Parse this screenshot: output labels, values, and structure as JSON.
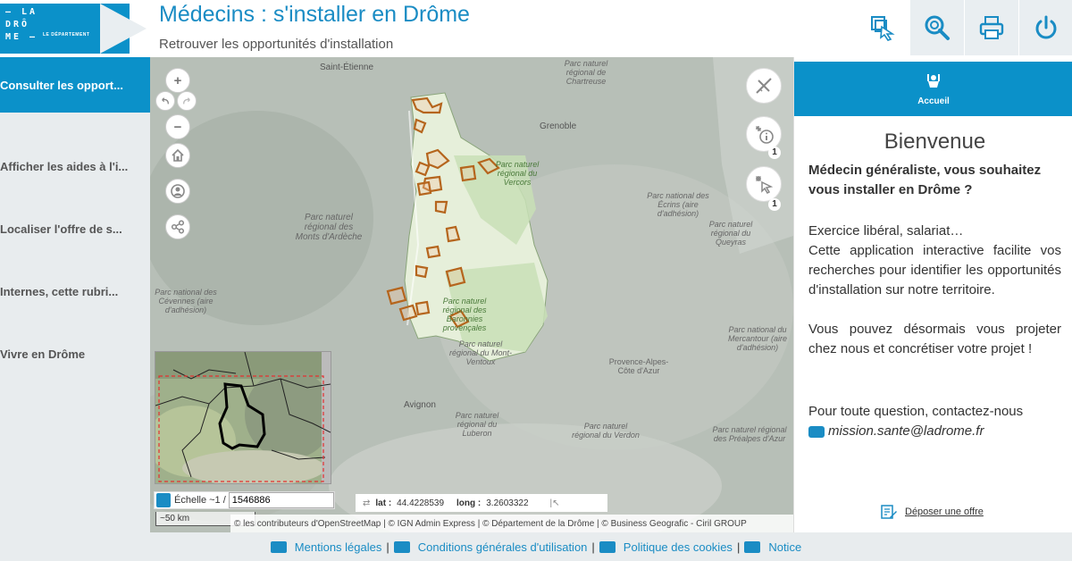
{
  "header": {
    "logo_lines": [
      "– LA",
      "DRÔ",
      "ME –"
    ],
    "logo_subtitle": "LE DÉPARTEMENT",
    "title": "Médecins : s'installer en Drôme",
    "subtitle": "Retrouver les opportunités d'installation",
    "buttons": [
      {
        "icon": "select-cursor-icon"
      },
      {
        "icon": "search-icon"
      },
      {
        "icon": "print-icon"
      },
      {
        "icon": "power-icon"
      }
    ]
  },
  "sidebar": {
    "items": [
      {
        "label": "Consulter les opport...",
        "active": true
      },
      {
        "label": "Afficher les aides à l'i..."
      },
      {
        "label": "Localiser l'offre de s..."
      },
      {
        "label": "Internes, cette rubri..."
      },
      {
        "label": "Vivre en Drôme"
      }
    ]
  },
  "map": {
    "labels": [
      "Saint-Étienne",
      "Parc naturel régional de Chartreuse",
      "Grenoble",
      "Parc naturel régional du Vercors",
      "Parc naturel régional des Monts d'Ardèche",
      "Parc national des Écrins (aire d'adhésion)",
      "Parc naturel régional du Queyras",
      "Parc naturel régional des Baronnies provençales",
      "Parc national des Cévennes (aire d'adhésion)",
      "Parc naturel régional du Mont-Ventoux",
      "Provence-Alpes-Côte d'Azur",
      "Avignon",
      "Parc naturel régional du Luberon",
      "Parc naturel régional du Verdon",
      "Parc national du Mercantour (aire d'adhésion)",
      "Parc naturel régional des Préalpes d'Azur"
    ],
    "zoom_in": "+",
    "zoom_out": "−",
    "badges": [
      "1",
      "1"
    ],
    "scale_label": "Échelle ~1 /",
    "scale_value": "1546886",
    "scalebar": "~50 km",
    "lat_label": "lat :",
    "lat_value": "44.4228539",
    "long_label": "long :",
    "long_value": "3.2603322",
    "attribution": "© les contributeurs d'OpenStreetMap | © IGN Admin Express | © Département de la Drôme | © Business Geografic - Ciril GROUP"
  },
  "panel": {
    "tab_label": "Accueil",
    "title": "Bienvenue",
    "question": "Médecin généraliste, vous souhaitez vous installer en Drôme ?",
    "p1": "Exercice libéral, salariat…",
    "p2": "Cette application interactive facilite vos recherches pour identifier les opportunités d'installation sur notre territoire.",
    "p3": "Vous pouvez désormais vous projeter chez nous et concrétiser votre projet !",
    "p4": "Pour toute question, contactez-nous",
    "email": "mission.sante@ladrome.fr",
    "deposit": "Déposer une offre"
  },
  "footer": {
    "links": [
      "Mentions légales",
      "Conditions générales d'utilisation",
      "Politique des cookies",
      "Notice"
    ],
    "separator": "|"
  },
  "colors": {
    "brand": "#0b91c9",
    "title": "#1a8cc4",
    "sidebar": "#e8ecee",
    "outline": "#b5651d"
  }
}
